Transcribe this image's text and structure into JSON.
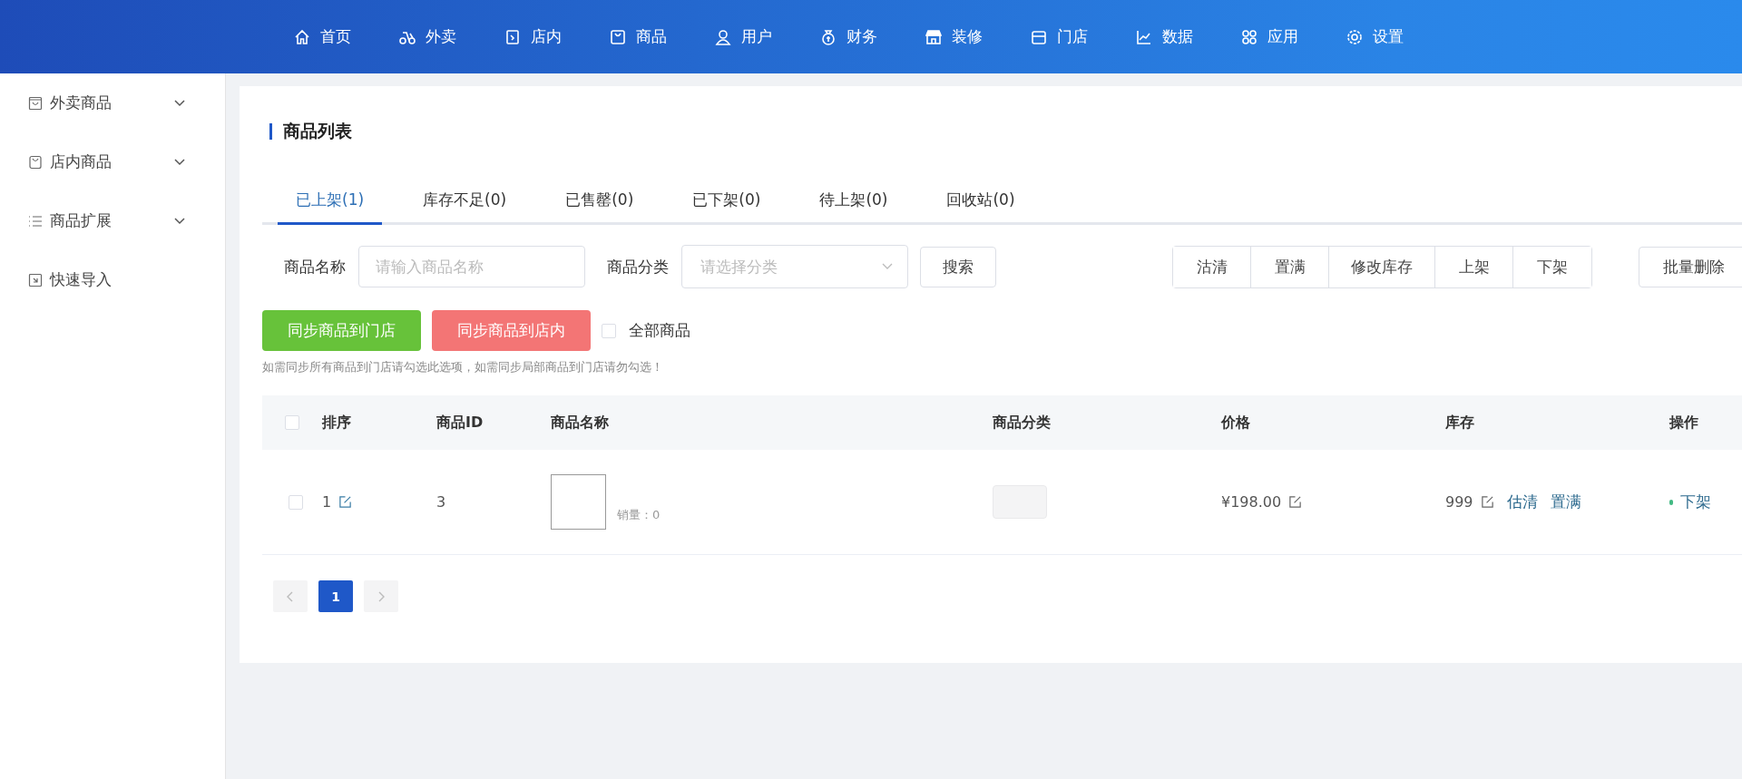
{
  "nav": [
    {
      "label": "首页"
    },
    {
      "label": "外卖"
    },
    {
      "label": "店内"
    },
    {
      "label": "商品"
    },
    {
      "label": "用户"
    },
    {
      "label": "财务"
    },
    {
      "label": "装修"
    },
    {
      "label": "门店"
    },
    {
      "label": "数据"
    },
    {
      "label": "应用"
    },
    {
      "label": "设置"
    }
  ],
  "sidebar": {
    "items": [
      {
        "label": "外卖商品",
        "has_submenu": true
      },
      {
        "label": "店内商品",
        "has_submenu": true
      },
      {
        "label": "商品扩展",
        "has_submenu": true
      },
      {
        "label": "快速导入",
        "has_submenu": false
      }
    ]
  },
  "page_title": "商品列表",
  "tabs": [
    {
      "label": "已上架(1)",
      "selected": true
    },
    {
      "label": "库存不足(0)",
      "selected": false
    },
    {
      "label": "已售罄(0)",
      "selected": false
    },
    {
      "label": "已下架(0)",
      "selected": false
    },
    {
      "label": "待上架(0)",
      "selected": false
    },
    {
      "label": "回收站(0)",
      "selected": false
    }
  ],
  "filters": {
    "name_label": "商品名称",
    "name_placeholder": "请输入商品名称",
    "category_label": "商品分类",
    "category_placeholder": "请选择分类",
    "search_button": "搜索"
  },
  "batch_buttons": [
    "沽清",
    "置满",
    "修改库存",
    "上架",
    "下架"
  ],
  "delete_button": "批量删除",
  "sync_buttons": [
    {
      "label": "同步商品到门店",
      "color": "#67c23a"
    },
    {
      "label": "同步商品到店内",
      "color": "#f37575"
    }
  ],
  "all_products": {
    "label": "全部商品",
    "checked": false
  },
  "hint": "如需同步所有商品到门店请勾选此选项，如需同步局部商品到门店请勿勾选！",
  "table": {
    "header_checked": false,
    "columns": [
      "排序",
      "商品ID",
      "商品名称",
      "商品分类",
      "价格",
      "库存",
      "操作"
    ],
    "rows": [
      {
        "checked": false,
        "sort": "1",
        "id": "3",
        "sales": "销量：0",
        "price": "¥198.00",
        "stock": "999",
        "stock_actions": [
          "估清",
          "置满"
        ],
        "action": "下架"
      }
    ]
  },
  "pagination": {
    "prev_disabled": true,
    "next_disabled": true,
    "pages": [
      {
        "label": "1",
        "selected": true
      }
    ]
  }
}
